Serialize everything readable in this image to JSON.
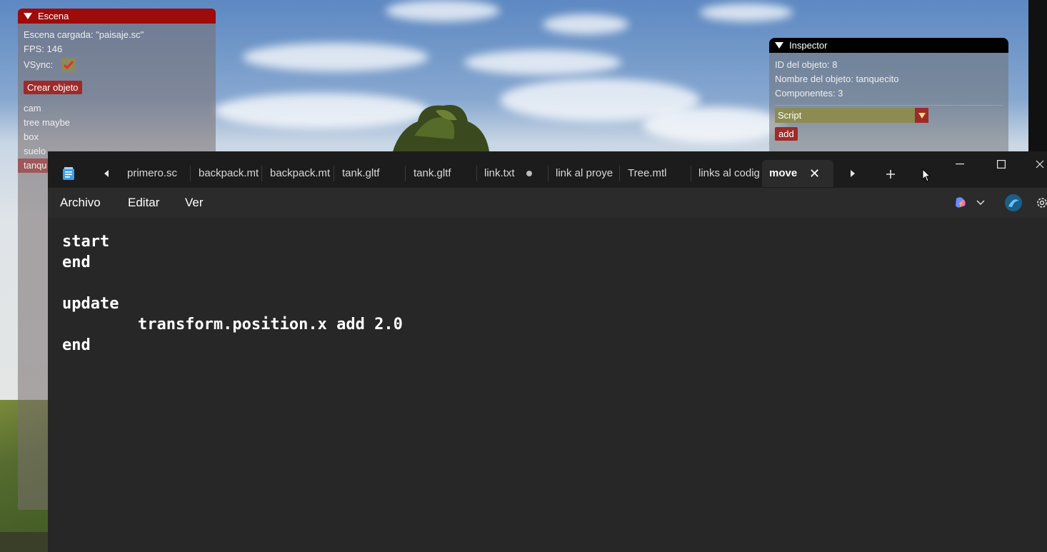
{
  "escena_panel": {
    "title": "Escena",
    "scene_loaded": "Escena cargada: \"paisaje.sc\"",
    "fps": "FPS: 146",
    "vsync_label": "VSync:",
    "vsync_checked": true,
    "create_button": "Crear objeto",
    "objects": [
      "cam",
      "tree maybe",
      "box",
      "suelo",
      "tanqu"
    ]
  },
  "inspector_panel": {
    "title": "Inspector",
    "object_id": "ID del objeto: 8",
    "object_name": "Nombre del objeto: tanquecito",
    "components": "Componentes: 3",
    "component_select": "Script",
    "add_button": "add"
  },
  "notepad": {
    "tabs": [
      {
        "label": "primero.sc"
      },
      {
        "label": "backpack.mt"
      },
      {
        "label": "backpack.mt"
      },
      {
        "label": "tank.gltf"
      },
      {
        "label": "tank.gltf"
      },
      {
        "label": "link.txt",
        "modified": true
      },
      {
        "label": "link al proye"
      },
      {
        "label": "Tree.mtl"
      },
      {
        "label": "links al codig"
      },
      {
        "label": "move",
        "active": true
      }
    ],
    "menu": [
      "Archivo",
      "Editar",
      "Ver"
    ],
    "content": "start\nend\n\nupdate\n        transform.position.x add 2.0\nend",
    "colors": {
      "background": "#272727",
      "tabbar": "#1c1c1c",
      "text": "#ffffff"
    }
  },
  "icons": [
    "notepad-icon",
    "tab-scroll-left-icon",
    "tab-scroll-right-icon",
    "new-tab-icon",
    "minimize-icon",
    "maximize-icon",
    "close-icon",
    "copilot-icon",
    "profile-icon",
    "settings-icon"
  ]
}
